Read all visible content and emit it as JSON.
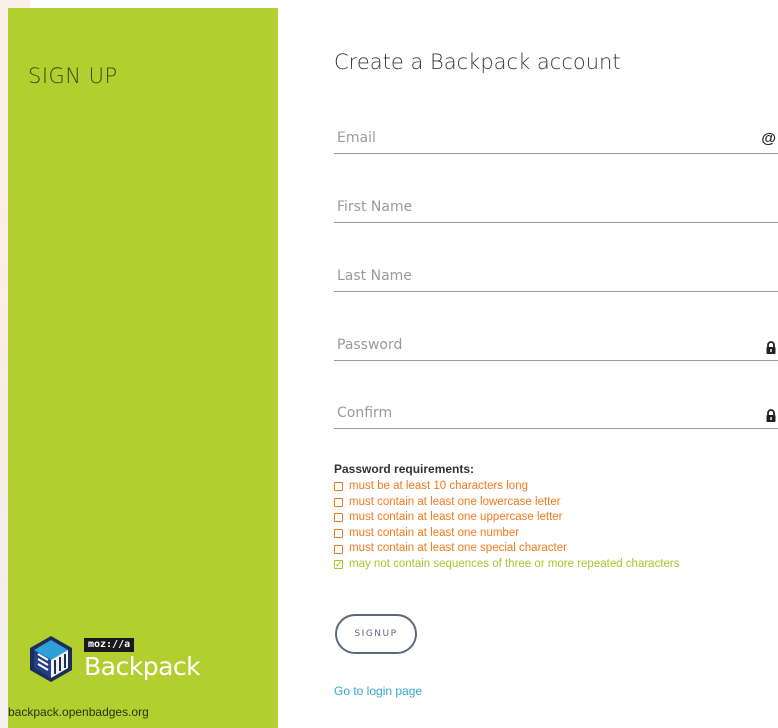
{
  "sidebar": {
    "title": "SIGN UP",
    "brand": {
      "tag": "moz://a",
      "name": "Backpack"
    },
    "url": "backpack.openbadges.org"
  },
  "main": {
    "title": "Create a Backpack account",
    "fields": {
      "email": {
        "placeholder": "Email",
        "icon": "at-icon"
      },
      "first_name": {
        "placeholder": "First Name"
      },
      "last_name": {
        "placeholder": "Last Name"
      },
      "password": {
        "placeholder": "Password",
        "icon": "lock-icon"
      },
      "confirm": {
        "placeholder": "Confirm",
        "icon": "lock-icon"
      }
    },
    "requirements": {
      "title": "Password requirements:",
      "items": [
        {
          "text": "must be at least 10 characters long",
          "met": false
        },
        {
          "text": "must contain at least one lowercase letter",
          "met": false
        },
        {
          "text": "must contain at least one uppercase letter",
          "met": false
        },
        {
          "text": "must contain at least one number",
          "met": false
        },
        {
          "text": "must contain at least one special character",
          "met": false
        },
        {
          "text": "may not contain sequences of three or more repeated characters",
          "met": true
        }
      ]
    },
    "signup_label": "SIGNUP",
    "login_link": "Go to login page"
  },
  "colors": {
    "sidebar": "#b3cf2f",
    "unmet": "#f07a1f",
    "met": "#a8c52b",
    "link": "#35a6d6"
  }
}
